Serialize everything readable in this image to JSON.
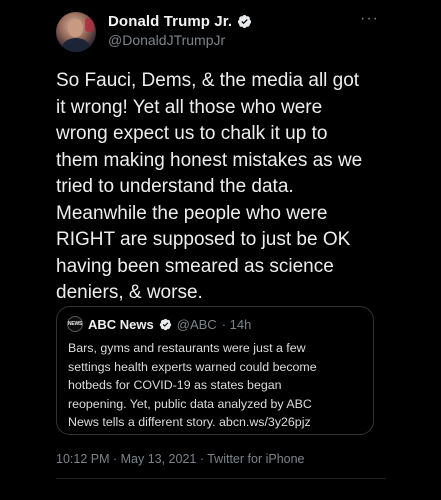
{
  "author": {
    "display_name": "Donald Trump Jr.",
    "handle": "@DonaldJTrumpJr",
    "verified": true
  },
  "more_menu_label": "···",
  "tweet": {
    "text": "So Fauci, Dems, & the media all got\nit wrong! Yet all those who were\nwrong expect us to chalk it up to\nthem making honest mistakes as we\ntried to understand the data.\nMeanwhile the people who were\nRIGHT are supposed to just be OK\nhaving been smeared as science\ndeniers, & worse."
  },
  "quoted_tweet": {
    "logo_text": "NEWS",
    "display_name": "ABC News",
    "verified": true,
    "handle": "@ABC",
    "time_ago": "· 14h",
    "text": "Bars, gyms and restaurants were just a few\nsettings health experts warned could become\nhotbeds for COVID-19 as states began\nreopening. Yet, public data analyzed by ABC\nNews tells a different story.  abcn.ws/3y26pjz"
  },
  "meta": {
    "timestamp": "10:12 PM · May 13, 2021 · Twitter for iPhone"
  },
  "colors": {
    "background": "#000000",
    "verified_badge": "#1d9bf0",
    "secondary_text": "#7d8489"
  }
}
